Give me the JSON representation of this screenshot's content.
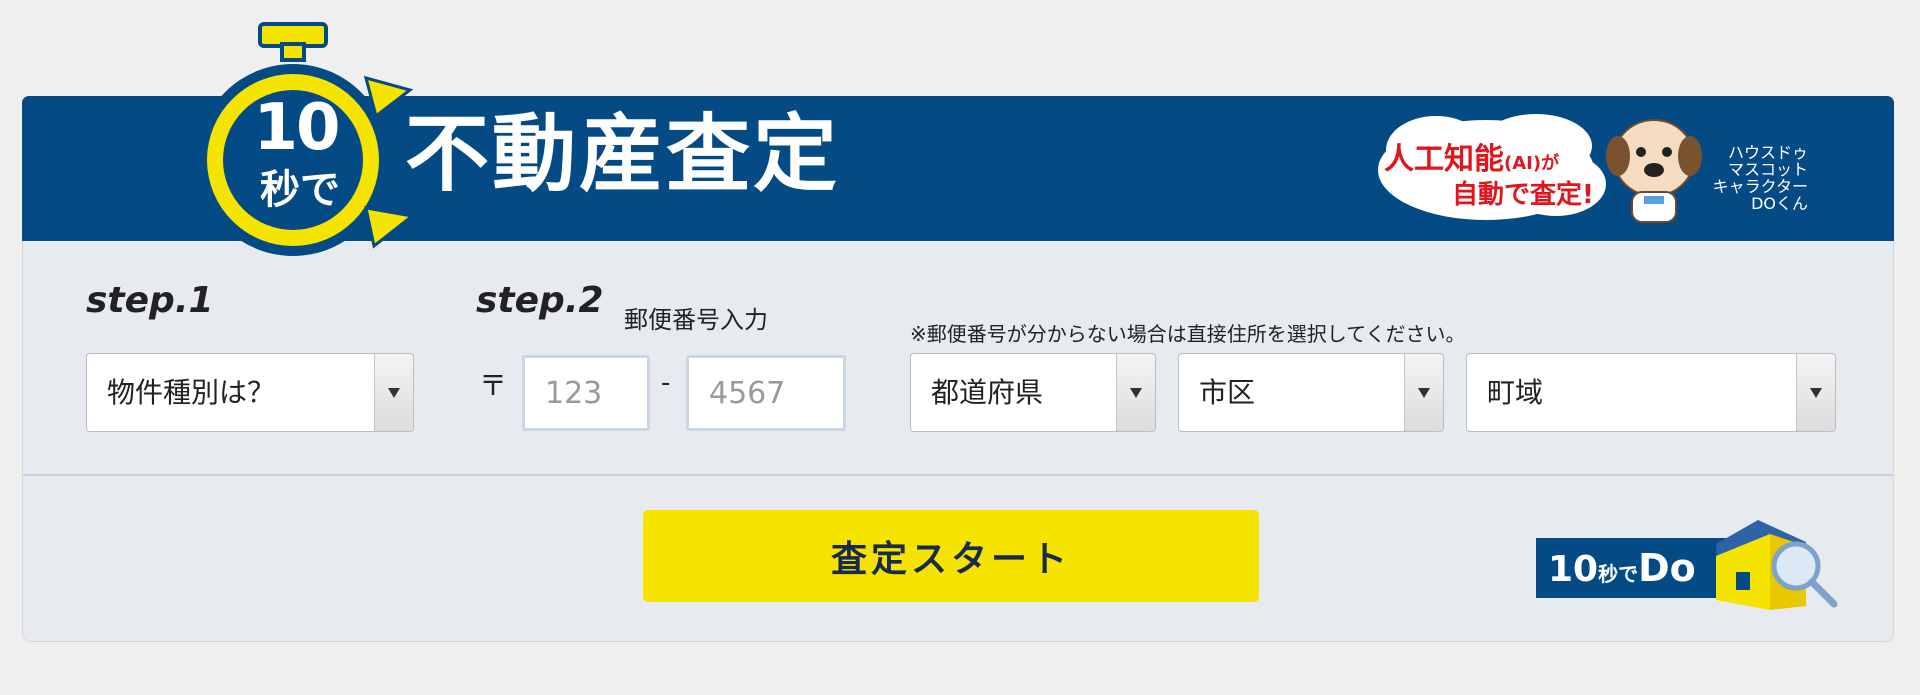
{
  "header": {
    "logo_big_number": "10",
    "logo_small_text": "秒で",
    "title": "不動産査定",
    "ai_badge_line1": "人工知能",
    "ai_badge_ai": "(AI)が",
    "ai_badge_line2": "自動で査定!",
    "mascot_caption": [
      "ハウスドゥ",
      "マスコット",
      "キャラクター",
      "DOくん"
    ]
  },
  "step1": {
    "label": "step.1",
    "property_type_select": "物件種別は？"
  },
  "step2": {
    "label": "step.2",
    "sublabel": "郵便番号入力",
    "postal_mark": "〒",
    "postal_dash": "-",
    "postal_first_placeholder": "123",
    "postal_second_placeholder": "4567"
  },
  "address": {
    "note": "※郵便番号が分からない場合は直接住所を選択してください。",
    "prefecture_select": "都道府県",
    "city_select": "市区",
    "town_select": "町域"
  },
  "actions": {
    "start_label": "査定スタート"
  },
  "footer_logo": {
    "text_big": "10",
    "text_mid": "秒で",
    "text_do": "Do"
  },
  "colors": {
    "header_bg": "#044a85",
    "accent_yellow": "#f5e400",
    "panel_bg": "#e7ebf0"
  }
}
